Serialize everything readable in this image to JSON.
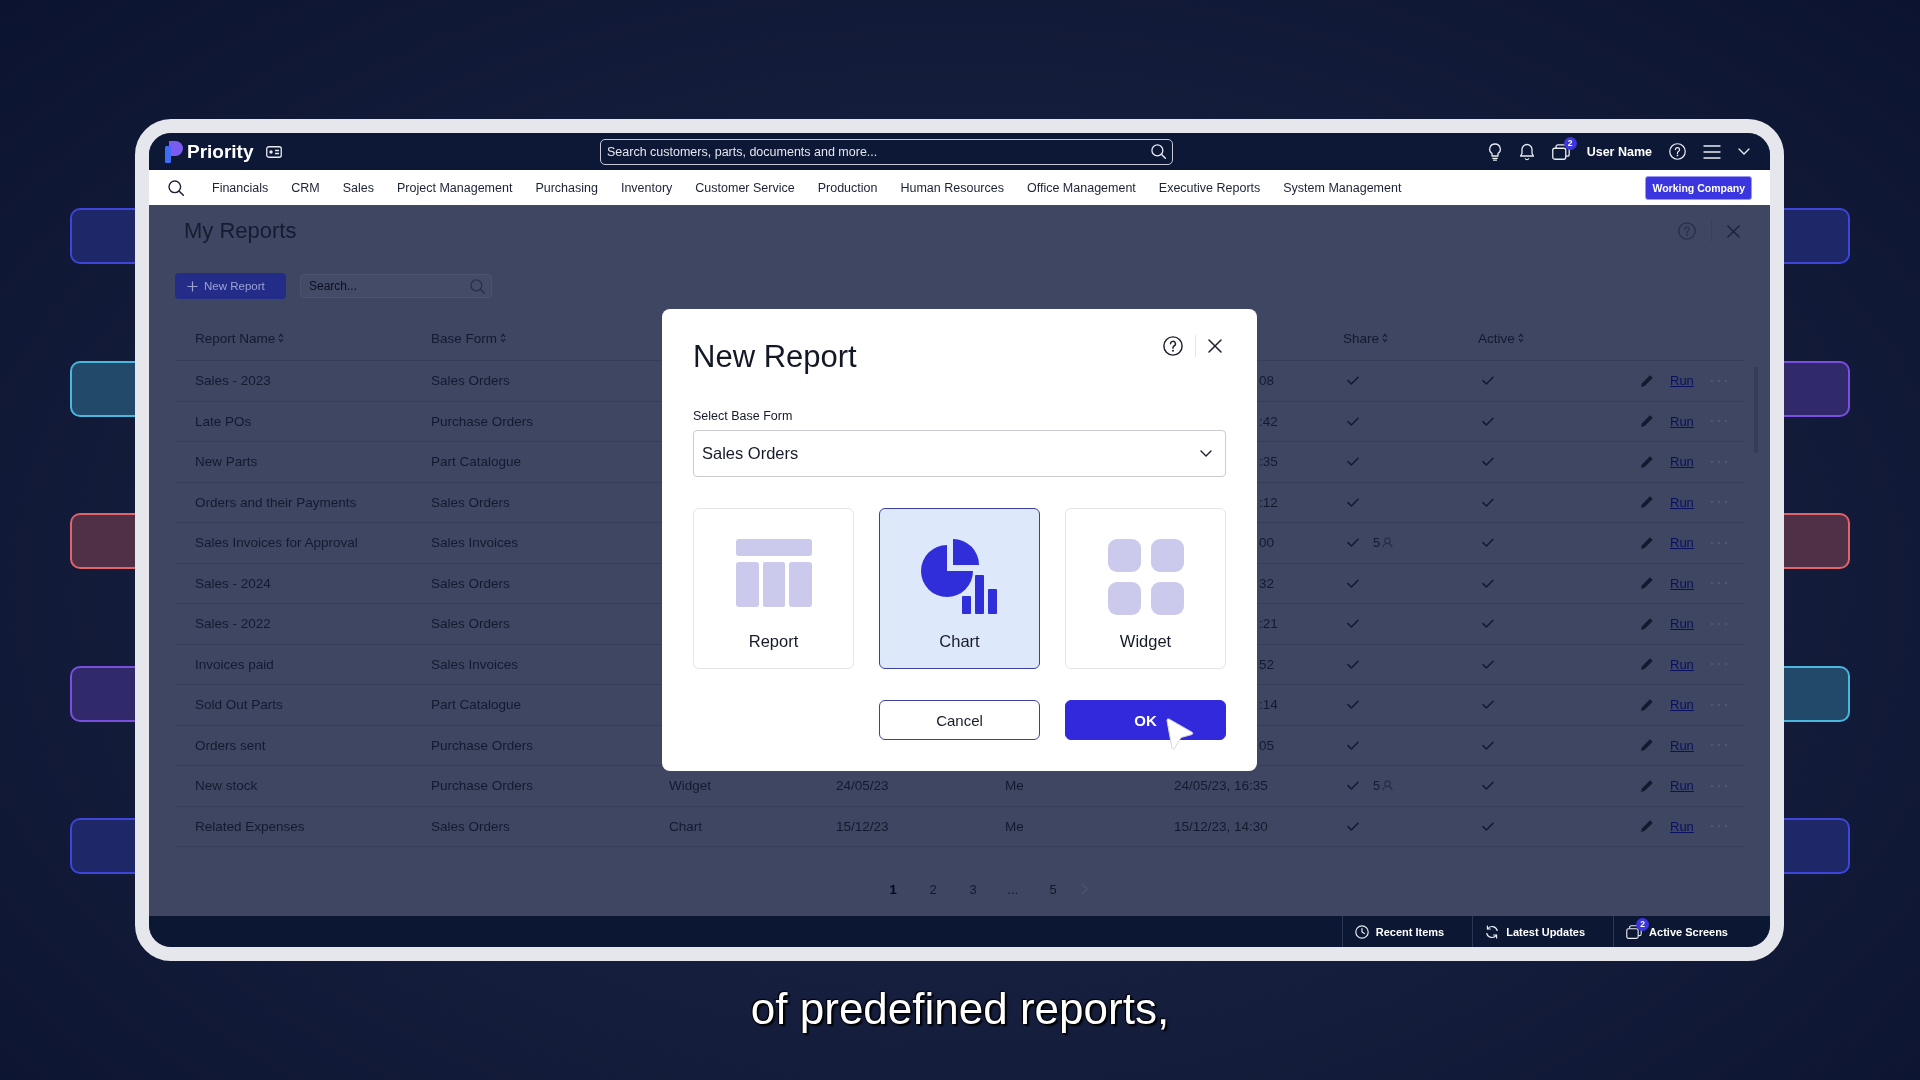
{
  "backdrop": {
    "left": [
      {
        "color": "#3d46d8"
      },
      {
        "color": "#4bb6de"
      },
      {
        "color": "#e0646a"
      },
      {
        "color": "#7a4fe0"
      },
      {
        "color": "#3d46d8"
      }
    ],
    "right": [
      {
        "color": "#3d46d8"
      },
      {
        "color": "#7a4fe0"
      },
      {
        "color": "#e0646a"
      },
      {
        "color": "#4bb6de"
      },
      {
        "color": "#3d46d8"
      }
    ]
  },
  "top_bar": {
    "logo": "Priority",
    "search": {
      "placeholder": "Search customers, parts, documents and more..."
    },
    "screens_badge": "2",
    "user_name": "User Name"
  },
  "menu_bar": {
    "items": [
      "Financials",
      "CRM",
      "Sales",
      "Project Management",
      "Purchasing",
      "Inventory",
      "Customer Service",
      "Production",
      "Human Resources",
      "Office Management",
      "Executive Reports",
      "System Management"
    ],
    "working_company": "Working Company"
  },
  "page": {
    "title": "My Reports",
    "new_button": "New Report",
    "search": {
      "placeholder": "Search..."
    }
  },
  "table": {
    "columns": [
      {
        "label": "Report Name",
        "sortable": true
      },
      {
        "label": "Base Form",
        "sortable": true
      },
      {
        "label": "Share",
        "sortable": true
      },
      {
        "label": "Active",
        "sortable": true
      }
    ],
    "rows": [
      {
        "report_name": "Sales - 2023",
        "base_form": "Sales Orders",
        "column_6": "08",
        "shared": true,
        "active": true,
        "action": "Run"
      },
      {
        "report_name": "Late POs",
        "base_form": "Purchase Orders",
        "column_6": ":42",
        "shared": true,
        "active": true,
        "action": "Run"
      },
      {
        "report_name": "New Parts",
        "base_form": "Part Catalogue",
        "column_6": ":35",
        "shared": true,
        "active": true,
        "action": "Run"
      },
      {
        "report_name": "Orders and their Payments",
        "base_form": "Sales Orders",
        "column_6": ":12",
        "shared": true,
        "active": true,
        "action": "Run"
      },
      {
        "report_name": "Sales Invoices for Approval",
        "base_form": "Sales Invoices",
        "column_6": "00",
        "shared": true,
        "share_count": "5",
        "active": true,
        "action": "Run"
      },
      {
        "report_name": "Sales - 2024",
        "base_form": "Sales Orders",
        "column_6": "32",
        "shared": true,
        "active": true,
        "action": "Run"
      },
      {
        "report_name": "Sales - 2022",
        "base_form": "Sales Orders",
        "column_6": ":21",
        "shared": true,
        "active": true,
        "action": "Run"
      },
      {
        "report_name": "Invoices paid",
        "base_form": "Sales Invoices",
        "column_6": "52",
        "shared": true,
        "active": true,
        "action": "Run"
      },
      {
        "report_name": "Sold Out Parts",
        "base_form": "Part Catalogue",
        "column_6": ":14",
        "shared": true,
        "active": true,
        "action": "Run"
      },
      {
        "report_name": "Orders sent",
        "base_form": "Purchase Orders",
        "column_6": "05",
        "shared": true,
        "active": true,
        "action": "Run"
      },
      {
        "report_name": "New stock",
        "base_form": "Purchase Orders",
        "column_3": "Widget",
        "column_4": "24/05/23",
        "column_5": "Me",
        "column_6": "24/05/23, 16:35",
        "shared": true,
        "share_count": "5",
        "active": true,
        "action": "Run"
      },
      {
        "report_name": "Related Expenses",
        "base_form": "Sales Orders",
        "column_3": "Chart",
        "column_4": "15/12/23",
        "column_5": "Me",
        "column_6": "15/12/23, 14:30",
        "shared": true,
        "active": true,
        "action": "Run"
      }
    ]
  },
  "pagination": {
    "pages": [
      {
        "label": "1",
        "kind": "page",
        "selected": true
      },
      {
        "label": "2",
        "kind": "page",
        "selected": false
      },
      {
        "label": "3",
        "kind": "page",
        "selected": false
      },
      {
        "label": "...",
        "kind": "ellipsis"
      },
      {
        "label": "5",
        "kind": "page",
        "selected": false
      }
    ]
  },
  "dialog": {
    "title": "New Report",
    "field": {
      "label": "Select Base Form",
      "value": "Sales Orders"
    },
    "types": [
      {
        "label": "Report",
        "kind": "table",
        "selected": false
      },
      {
        "label": "Chart",
        "kind": "chart",
        "selected": true
      },
      {
        "label": "Widget",
        "kind": "widget",
        "selected": false
      }
    ],
    "buttons": [
      {
        "label": "Cancel",
        "kind": "secondary"
      },
      {
        "label": "OK",
        "kind": "primary"
      }
    ]
  },
  "status_bar": {
    "items": [
      {
        "label": "Recent Items",
        "kind": "recent"
      },
      {
        "label": "Latest Updates",
        "kind": "updates"
      },
      {
        "label": "Active Screens",
        "kind": "screens",
        "badge": "2"
      }
    ]
  },
  "caption": "of predefined reports,"
}
